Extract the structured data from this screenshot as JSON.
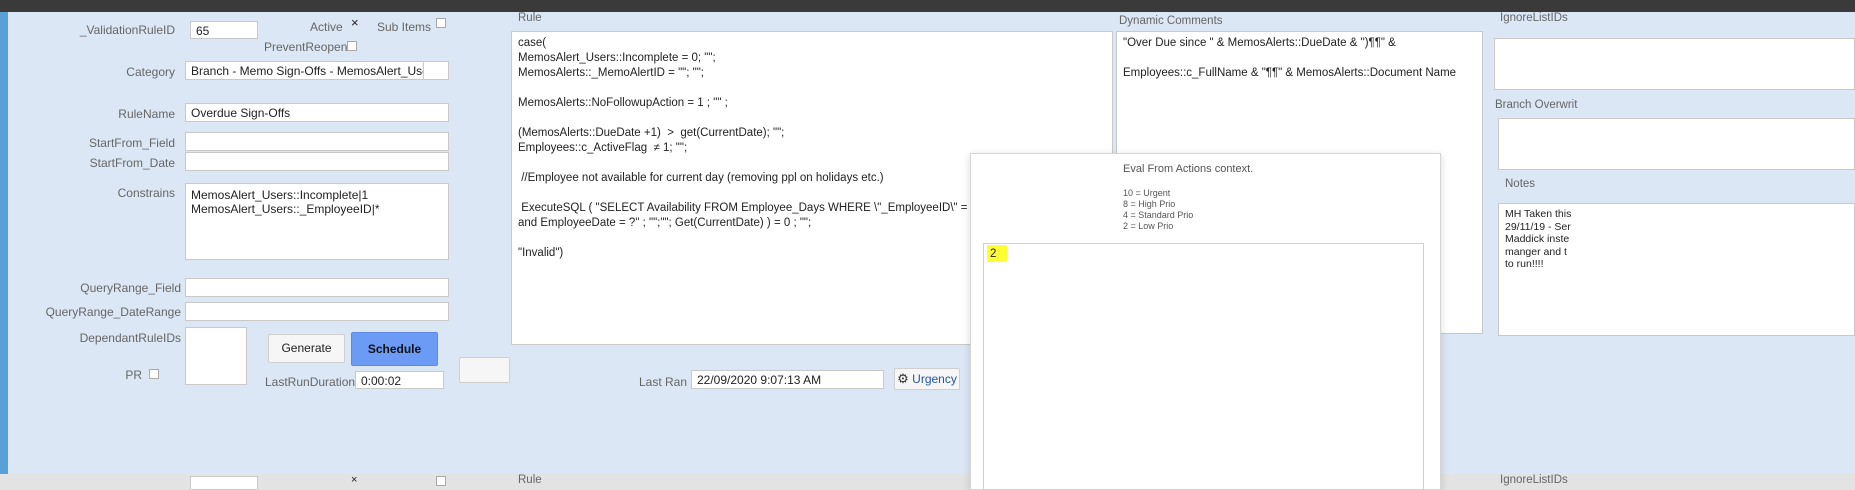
{
  "form": {
    "validation_rule_id_label": "_ValidationRuleID",
    "validation_rule_id_value": "65",
    "active_label": "Active",
    "active_mark": "×",
    "sub_items_label": "Sub Items",
    "prevent_reopen_label": "PreventReopen",
    "category_label": "Category",
    "category_value": "Branch - Memo Sign-Offs - MemosAlert_Users",
    "rule_name_label": "RuleName",
    "rule_name_value": "Overdue Sign-Offs",
    "start_from_field_label": "StartFrom_Field",
    "start_from_date_label": "StartFrom_Date",
    "constrains_label": "Constrains",
    "constrains_value": "MemosAlert_Users::Incomplete|1\nMemosAlert_Users::_EmployeeID|*",
    "query_range_field_label": "QueryRange_Field",
    "query_range_daterange_label": "QueryRange_DateRange",
    "dependant_rule_ids_label": "DependantRuleIDs",
    "pr_label": "PR",
    "generate_label": "Generate",
    "schedule_label": "Schedule",
    "last_run_duration_label": "LastRunDuration",
    "last_run_duration_value": "0:00:02",
    "last_ran_label": "Last Ran",
    "last_ran_value": "22/09/2020 9:07:13 AM",
    "urgency_label": "Urgency"
  },
  "rule": {
    "label": "Rule",
    "text": "case(\nMemosAlert_Users::Incomplete = 0; \"\";\nMemosAlerts::_MemoAlertID = \"\"; \"\";\n\nMemosAlerts::NoFollowupAction = 1 ; \"\" ;\n\n(MemosAlerts::DueDate +1)  >  get(CurrentDate); \"\";\nEmployees::c_ActiveFlag  ≠ 1; \"\";\n\n //Employee not available for current day (removing ppl on holidays etc.)\n\n ExecuteSQL ( \"SELECT Availability FROM Employee_Days WHERE \\\"_EmployeeID\\\" = \" &  MemosA\nand EmployeeDate = ?\" ; \"\";\"\"; Get(CurrentDate) ) = 0 ; \"\";\n\n\"Invalid\")"
  },
  "dynamic_comments": {
    "label": "Dynamic Comments",
    "text": "\"Over Due since \" & MemosAlerts::DueDate & \")¶¶\" &\n\nEmployees::c_FullName & \"¶¶\" & MemosAlerts::Document Name"
  },
  "right": {
    "ignore_list_label": "IgnoreListIDs",
    "branch_overwrite_label": "Branch Overwrit",
    "notes_label": "Notes",
    "notes_text": "MH Taken this\n29/11/19 - Ser\nMaddick inste\nmanger and t\nto run!!!!"
  },
  "popover": {
    "title": "Eval From Actions context.",
    "priorities": [
      "10 = Urgent",
      "8 = High Prio",
      "4 = Standard Prio",
      "2 = Low Prio"
    ],
    "value": "2"
  },
  "next_row": {
    "rule_label": "Rule",
    "ignore_list_label": "IgnoreListIDs"
  },
  "colors": {
    "accent_blue": "#6c9bf5",
    "panel_bg": "#dbe7f5",
    "highlight": "#ffff33"
  },
  "icons": {
    "urgency": "gear-icon"
  }
}
